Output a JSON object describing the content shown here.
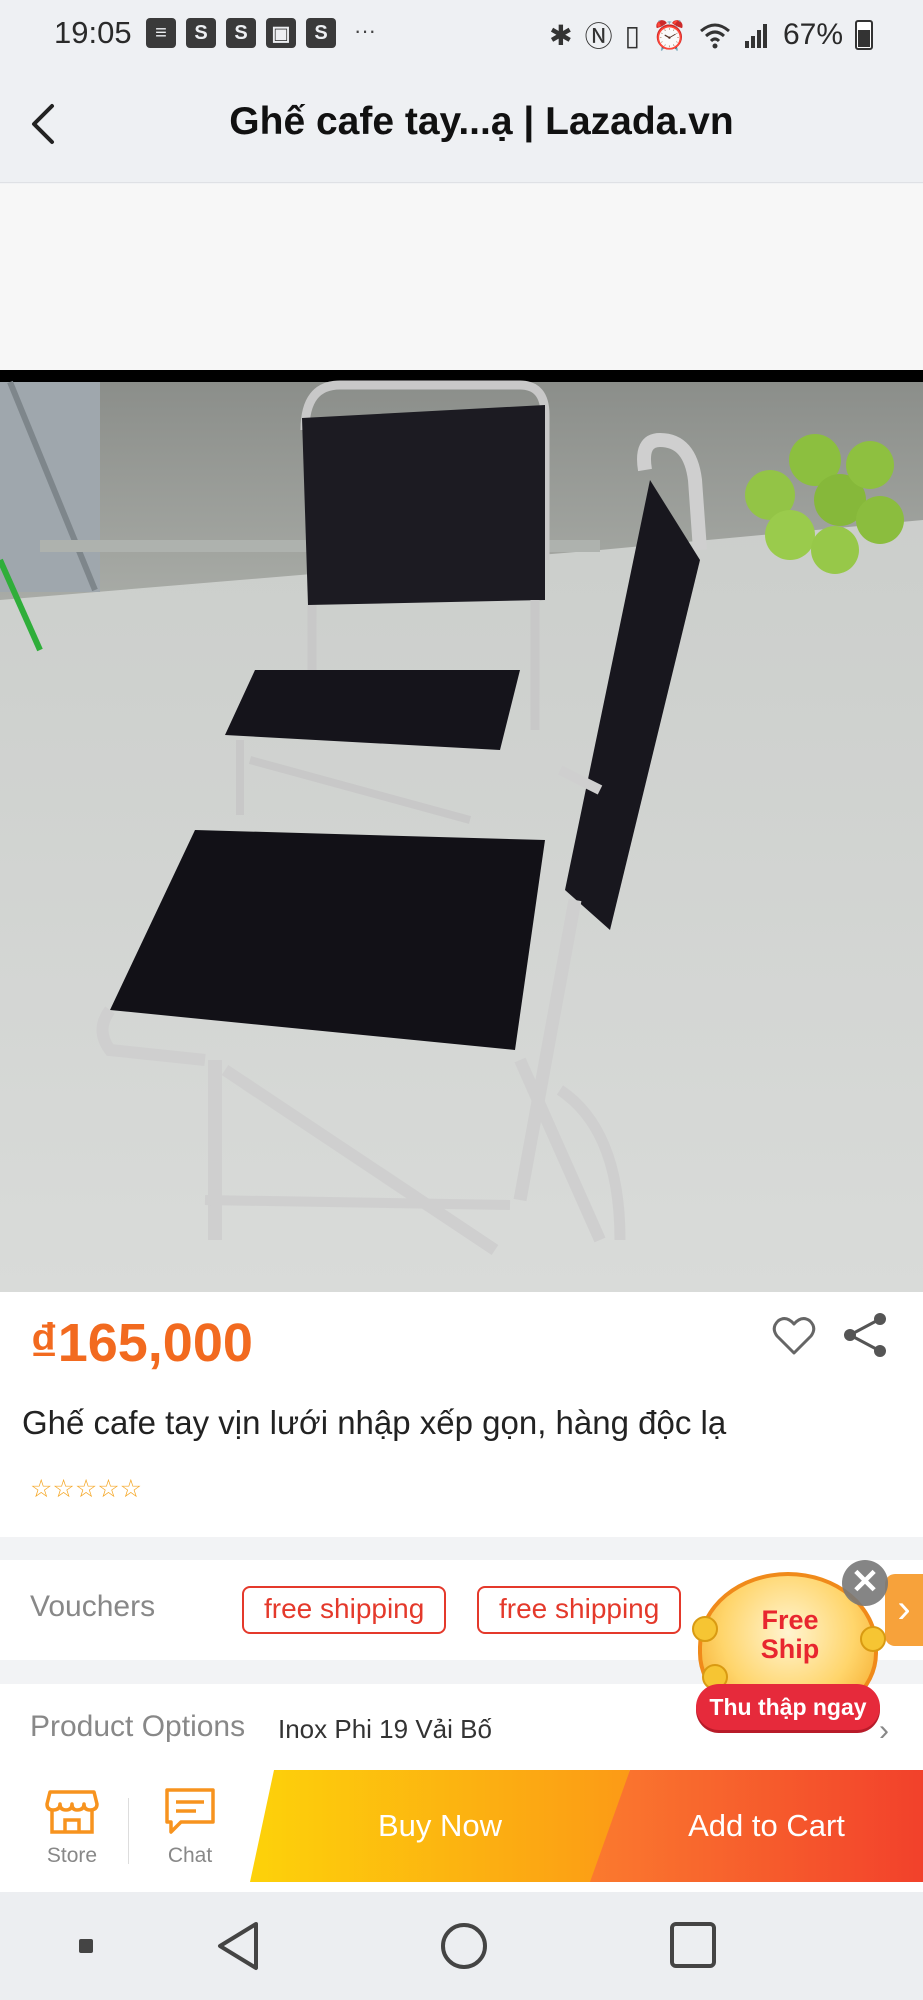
{
  "status_bar": {
    "time": "19:05",
    "notification_icons": [
      "message-icon",
      "shopee-icon",
      "shopee-icon",
      "gallery-icon",
      "shopee-icon"
    ],
    "more": "···",
    "battery": "67%",
    "system_icons": [
      "bluetooth-icon",
      "nfc-icon",
      "vibrate-icon",
      "alarm-icon",
      "wifi-icon",
      "signal-icon",
      "battery-icon"
    ]
  },
  "header": {
    "title": "Ghế cafe tay...ạ | Lazada.vn",
    "back_icon": "chevron-left-icon"
  },
  "product": {
    "price": "₫165,000",
    "title": "Ghế cafe tay vịn lưới nhập xếp gọn, hàng độc lạ",
    "rating_stars": "☆☆☆☆☆",
    "wishlist_icon": "heart-outline-icon",
    "share_icon": "share-icon"
  },
  "vouchers": {
    "label": "Vouchers",
    "tags": [
      "free shipping",
      "free shipping"
    ],
    "next_icon": "chevron-right-icon"
  },
  "product_options": {
    "label": "Product Options",
    "value": "Inox Phi 19 Vải Bố"
  },
  "free_ship_badge": {
    "title_line1": "Free",
    "title_line2": "Ship",
    "cta": "Thu thập ngay",
    "close": "✕"
  },
  "action_bar": {
    "store_label": "Store",
    "chat_label": "Chat",
    "buy_now": "Buy Now",
    "add_to_cart": "Add to Cart"
  },
  "colors": {
    "price": "#f26a1f",
    "voucher_red": "#e4392b",
    "buy_now_start": "#fdd20a",
    "add_to_cart_end": "#f2412b",
    "icon_orange": "#f7931e"
  }
}
